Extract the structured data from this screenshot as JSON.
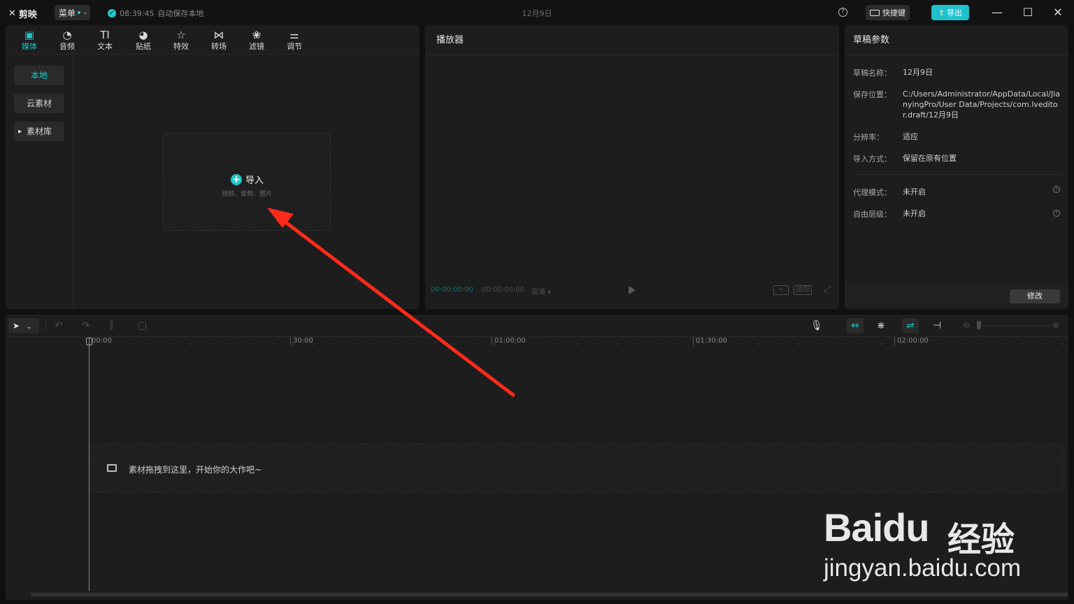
{
  "app": {
    "title": "剪映",
    "menu_label": "菜单",
    "save_time": "08:39:45",
    "save_status": "自动保存本地",
    "project_title": "12月9日",
    "shortcut_label": "快捷键",
    "export_label": "导出",
    "accent_color": "#20c8c8"
  },
  "tool_tabs": [
    {
      "label": "媒体",
      "icon": "media-icon",
      "active": true
    },
    {
      "label": "音频",
      "icon": "audio-icon"
    },
    {
      "label": "文本",
      "icon": "text-icon"
    },
    {
      "label": "贴纸",
      "icon": "sticker-icon"
    },
    {
      "label": "特效",
      "icon": "effects-icon"
    },
    {
      "label": "转场",
      "icon": "transition-icon"
    },
    {
      "label": "滤镜",
      "icon": "filter-icon"
    },
    {
      "label": "调节",
      "icon": "adjust-icon"
    }
  ],
  "media_nav": {
    "local": "本地",
    "cloud": "云素材",
    "library": "素材库"
  },
  "import": {
    "label": "导入",
    "hint": "视频、音频、图片"
  },
  "player": {
    "title": "播放器",
    "current_time": "00:00:00:00",
    "total_time": "00:00:00:00",
    "quality": "高清",
    "ratio_label": "适应"
  },
  "draft": {
    "title": "草稿参数",
    "rows": [
      {
        "key": "草稿名称：",
        "value": "12月9日"
      },
      {
        "key": "保存位置：",
        "value": "C:/Users/Administrator/AppData/Local/JianyingPro/User Data/Projects/com.lveditor.draft/12月9日"
      },
      {
        "key": "分辨率：",
        "value": "适应"
      },
      {
        "key": "导入方式：",
        "value": "保留在原有位置"
      },
      {
        "key": "代理模式：",
        "value": "未开启"
      },
      {
        "key": "自由层级：",
        "value": "未开启"
      }
    ],
    "modify_label": "修改"
  },
  "timeline": {
    "ruler": [
      "00:00",
      "30:00",
      "01:00:00",
      "01:30:00",
      "02:00:00"
    ],
    "drop_hint": "素材拖拽到这里，开始你的大作吧~"
  },
  "watermark": {
    "brand": "Bai",
    "brand_du": "du",
    "brand_jy": "经验",
    "url": "jingyan.baidu.com"
  }
}
